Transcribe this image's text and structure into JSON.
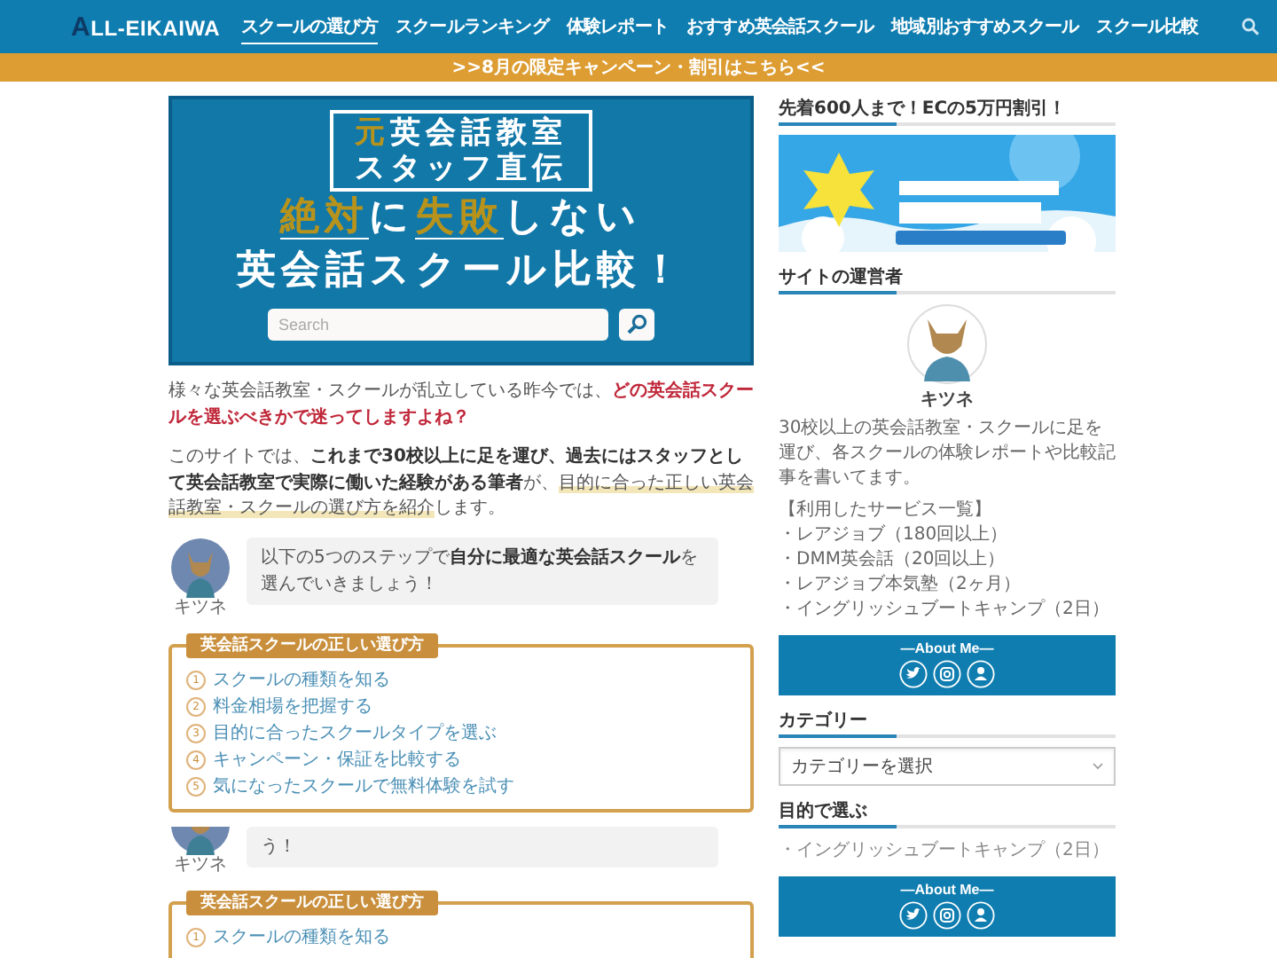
{
  "header": {
    "logo": "ALL-EIKAIWA",
    "nav": [
      {
        "label": "スクールの選び方",
        "selected": true
      },
      {
        "label": "スクールランキング",
        "selected": false
      },
      {
        "label": "体験レポート",
        "selected": false
      },
      {
        "label": "おすすめ英会話スクール",
        "selected": false
      },
      {
        "label": "地域別おすすめスクール",
        "selected": false
      },
      {
        "label": "スクール比較",
        "selected": false
      }
    ]
  },
  "campaign_banner": {
    "text": ">>8月の限定キャンペーン・割引はこちら<<"
  },
  "hero": {
    "badge_lines": [
      [
        {
          "text": "元",
          "kind": "accent"
        },
        {
          "text": "英会話教室",
          "kind": "plain"
        }
      ],
      [
        {
          "text": "スタッフ直伝",
          "kind": "plain"
        }
      ]
    ],
    "headline_lines": [
      [
        {
          "text": "絶対",
          "kind": "emphasis"
        },
        {
          "text": "に",
          "kind": "plain"
        },
        {
          "text": "失敗",
          "kind": "emphasis"
        },
        {
          "text": "しない",
          "kind": "plain"
        }
      ],
      [
        {
          "text": "英会話スクール比較！",
          "kind": "plain"
        }
      ]
    ],
    "search": {
      "placeholder": "Search"
    }
  },
  "content": [
    {
      "kind": "paragraph",
      "segments": [
        {
          "text": "様々な英会話教室・スクールが乱立している昨今では、",
          "kind": "plain"
        },
        {
          "text": "どの英会話スクールを選ぶべきかで迷ってしますよね？",
          "kind": "alert"
        }
      ]
    },
    {
      "kind": "paragraph",
      "segments": [
        {
          "text": "このサイトでは、",
          "kind": "plain"
        },
        {
          "text": "これまで30校以上に足を運び、過去にはスタッフとして英会話教室で実際に働いた経験がある筆者",
          "kind": "bold"
        },
        {
          "text": "が、",
          "kind": "plain"
        },
        {
          "text": "目的に合った正しい英会話教室・スクールの選び方を紹介",
          "kind": "marker"
        },
        {
          "text": "します。",
          "kind": "plain"
        }
      ]
    },
    {
      "kind": "speech",
      "speaker": "キツネ",
      "avatar_cropped": false,
      "segments": [
        {
          "text": "以下の5つのステップで",
          "kind": "plain"
        },
        {
          "text": "自分に最適な英会話スクール",
          "kind": "bold"
        },
        {
          "text": "を選んでいきましょう！",
          "kind": "plain"
        }
      ]
    },
    {
      "kind": "steps",
      "title": "英会話スクールの正しい選び方",
      "items": [
        {
          "number": "1",
          "text": "スクールの種類を知る"
        },
        {
          "number": "2",
          "text": "料金相場を把握する"
        },
        {
          "number": "3",
          "text": "目的に合ったスクールタイプを選ぶ"
        },
        {
          "number": "4",
          "text": "キャンペーン・保証を比較する"
        },
        {
          "number": "5",
          "text": "気になったスクールで無料体験を試す"
        }
      ]
    },
    {
      "kind": "speech",
      "speaker": "キツネ",
      "avatar_cropped": true,
      "segments": [
        {
          "text": "う！",
          "kind": "plain"
        }
      ]
    },
    {
      "kind": "steps",
      "title": "英会話スクールの正しい選び方",
      "items": [
        {
          "number": "1",
          "text": "スクールの種類を知る"
        }
      ]
    }
  ],
  "sidebar": {
    "widgets": [
      {
        "kind": "ad",
        "title": "先着600人まで！ECの5万円割引！"
      },
      {
        "kind": "profile",
        "title": "サイトの運営者",
        "name": "キツネ",
        "bio": "30校以上の英会話教室・スクールに足を運び、各スクールの体験レポートや比較記事を書いてます。",
        "services_title": "【利用したサービス一覧】",
        "services": [
          "・レアジョブ（180回以上）",
          "・DMM英会話（20回以上）",
          "・レアジョブ本気塾（2ヶ月）",
          "・イングリッシュブートキャンプ（2日）"
        ]
      },
      {
        "kind": "about",
        "title": "―About Me―"
      },
      {
        "kind": "category",
        "title": "カテゴリー",
        "select": {
          "value": "カテゴリーを選択"
        }
      },
      {
        "kind": "list",
        "title": "目的で選ぶ",
        "items": [
          "・イングリッシュブートキャンプ（2日）"
        ]
      },
      {
        "kind": "about",
        "title": "―About Me―"
      }
    ]
  }
}
